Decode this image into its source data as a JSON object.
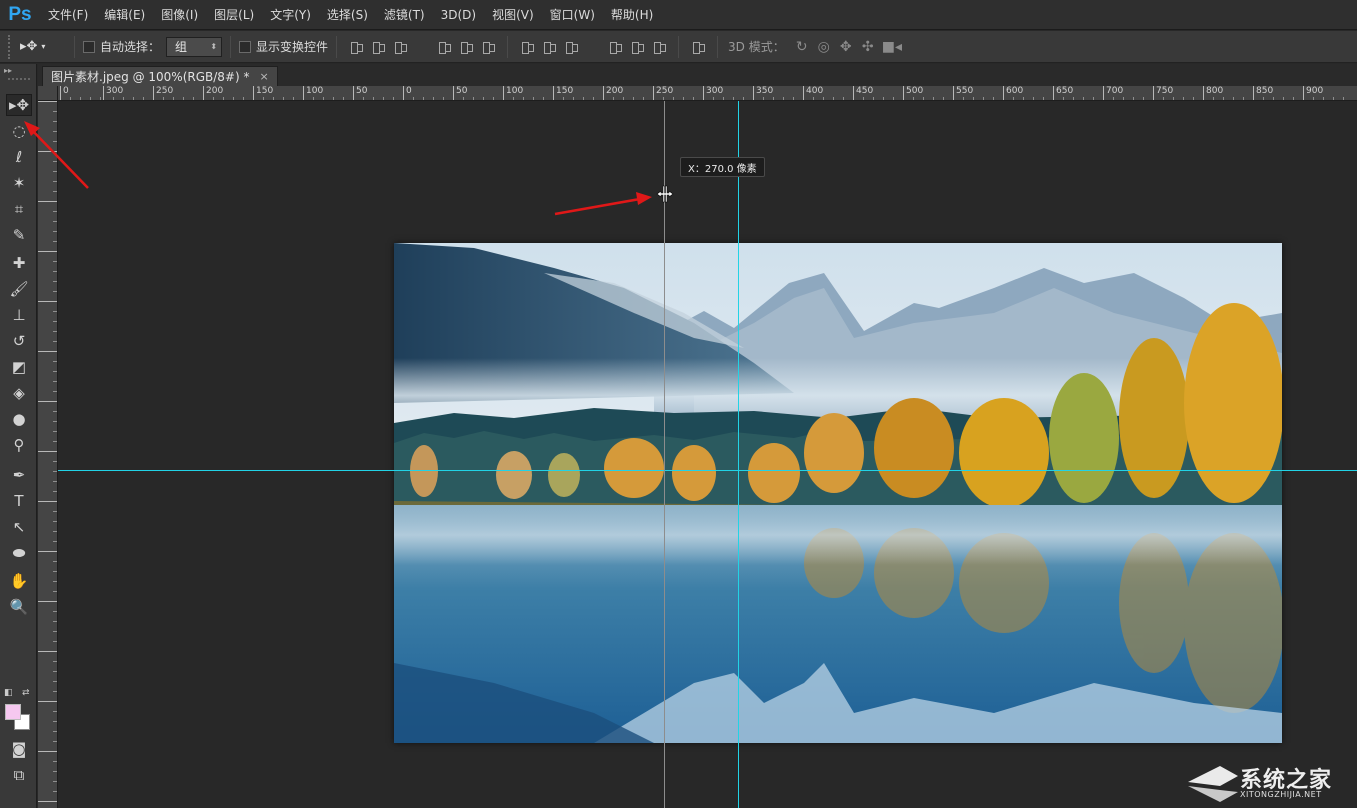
{
  "app": {
    "logo": "Ps",
    "accent_color": "#30a6f2",
    "guide_color": "#22d3e6"
  },
  "menu": {
    "items": [
      "文件(F)",
      "编辑(E)",
      "图像(I)",
      "图层(L)",
      "文字(Y)",
      "选择(S)",
      "滤镜(T)",
      "3D(D)",
      "视图(V)",
      "窗口(W)",
      "帮助(H)"
    ]
  },
  "options": {
    "auto_select_label": "自动选择：",
    "auto_select_value": "组",
    "show_transform_label": "显示变换控件",
    "mode_3d_label": "3D 模式："
  },
  "document": {
    "tab_title": "图片素材.jpeg @ 100%(RGB/8#) *",
    "close_glyph": "×"
  },
  "rulers": {
    "top_labels": [
      "0",
      "300",
      "250",
      "200",
      "150",
      "100",
      "50",
      "0",
      "50",
      "100",
      "150",
      "200",
      "250",
      "300",
      "350",
      "400",
      "450",
      "500",
      "550",
      "600",
      "650",
      "700",
      "750",
      "800",
      "850",
      "900"
    ]
  },
  "tooltip": {
    "text": "X：270.0 像素"
  },
  "tools": [
    {
      "name": "move-tool",
      "glyph": "▸✥"
    },
    {
      "name": "elliptical-marquee-tool",
      "glyph": "◌"
    },
    {
      "name": "lasso-tool",
      "glyph": "ℓ"
    },
    {
      "name": "magic-wand-tool",
      "glyph": "✶"
    },
    {
      "name": "crop-tool",
      "glyph": "⌗"
    },
    {
      "name": "eyedropper-tool",
      "glyph": "✎"
    },
    {
      "name": "healing-brush-tool",
      "glyph": "✚"
    },
    {
      "name": "brush-tool",
      "glyph": "🖌"
    },
    {
      "name": "clone-stamp-tool",
      "glyph": "⊥"
    },
    {
      "name": "history-brush-tool",
      "glyph": "↺"
    },
    {
      "name": "eraser-tool",
      "glyph": "◩"
    },
    {
      "name": "paint-bucket-tool",
      "glyph": "◈"
    },
    {
      "name": "blur-tool",
      "glyph": "●"
    },
    {
      "name": "dodge-tool",
      "glyph": "⚲"
    },
    {
      "name": "pen-tool",
      "glyph": "✒"
    },
    {
      "name": "type-tool",
      "glyph": "T"
    },
    {
      "name": "path-selection-tool",
      "glyph": "↖"
    },
    {
      "name": "ellipse-tool",
      "glyph": "⬬"
    },
    {
      "name": "hand-tool",
      "glyph": "✋"
    },
    {
      "name": "zoom-tool",
      "glyph": "🔍"
    }
  ],
  "colors": {
    "foreground": "#f6c8f0",
    "background": "#ffffff"
  },
  "watermark": {
    "text": "系统之家",
    "sub": "XITONGZHIJIA.NET"
  }
}
